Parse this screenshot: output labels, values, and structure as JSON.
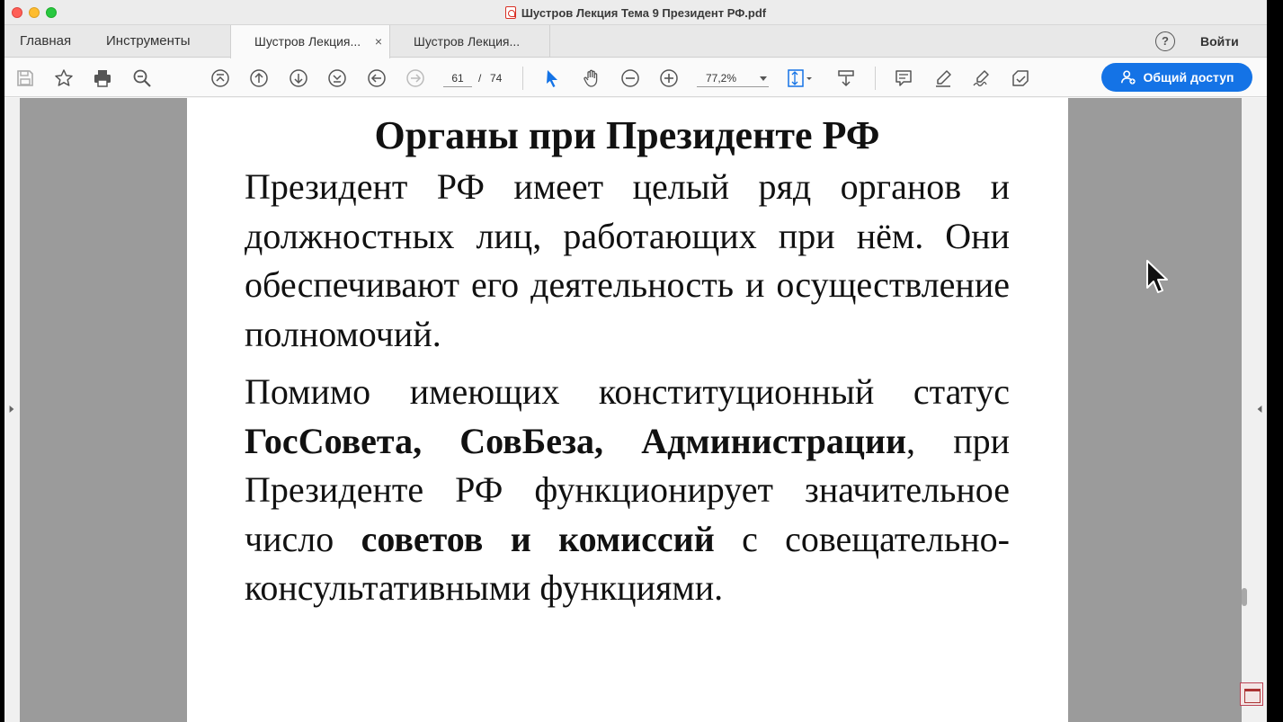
{
  "window": {
    "title": "Шустров Лекция Тема 9 Президент РФ.pdf"
  },
  "tabbar": {
    "home": "Главная",
    "tools": "Инструменты",
    "tabs": [
      {
        "label": "Шустров Лекция...",
        "close": "×"
      },
      {
        "label": "Шустров Лекция..."
      }
    ],
    "help": "?",
    "signin": "Войти"
  },
  "toolbar": {
    "page_current": "61",
    "page_separator": "/",
    "page_total": "74",
    "zoom": "77,2%",
    "share_label": "Общий доступ"
  },
  "document": {
    "heading": "Органы при Президенте РФ",
    "paragraph1": "Президент РФ имеет целый ряд органов и должностных лиц, работающих при нём. Они обеспечивают его деятельность и осуществление полномочий.",
    "paragraph2": {
      "part1": "Помимо имеющих конституционный статус ",
      "bold1": "ГосСовета, СовБеза, Администрации",
      "part2": ", при Президенте РФ функционирует значительное число ",
      "bold2": "советов и комиссий",
      "part3": " с совещательно-консультативными функциями."
    }
  },
  "icons": {
    "save": "save-icon",
    "bookmark": "star-icon",
    "print": "print-icon",
    "zoom_out_search": "zoom-search-icon",
    "first_page": "first-page-icon",
    "prev_page": "prev-page-icon",
    "next_page": "next-page-icon",
    "last_page": "last-page-icon",
    "back": "back-icon",
    "forward": "forward-icon",
    "select": "arrow-pointer-icon",
    "hand": "hand-icon",
    "zoom_out": "minus-circle-icon",
    "zoom_in": "plus-circle-icon",
    "colors": {
      "accent": "#1473e6",
      "close": "#fe5f57",
      "minimize": "#febc2e",
      "maximize": "#28c840"
    }
  }
}
